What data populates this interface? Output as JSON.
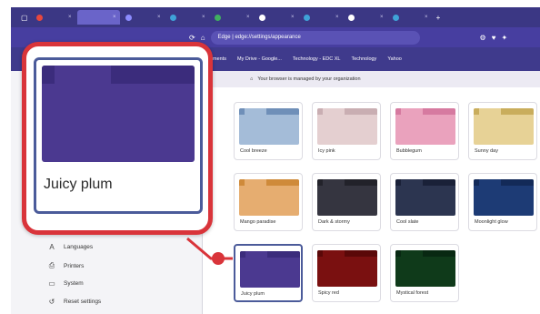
{
  "browser": {
    "tabs": [
      {
        "label": "",
        "color": "#e8473d"
      },
      {
        "label": "",
        "color": "#6a64c9"
      },
      {
        "label": "",
        "color": "#8c8cff"
      },
      {
        "label": "",
        "color": "#3fa3d8"
      },
      {
        "label": "",
        "color": "#40b060"
      },
      {
        "label": "",
        "color": "#ffffff"
      },
      {
        "label": "",
        "color": "#3fa3d8"
      },
      {
        "label": "",
        "color": "#ffffff"
      },
      {
        "label": "",
        "color": "#3fa3d8"
      }
    ],
    "address": "Edge | edge://settings/appearance",
    "bookmarks": [
      "ments",
      "My Drive - Google...",
      "Technology - EDC XL",
      "Technology",
      "Yahoo"
    ]
  },
  "banner": {
    "text": "Your browser is managed by your organization"
  },
  "sidebar": {
    "items": [
      {
        "label": "Languages",
        "icon": "language-icon"
      },
      {
        "label": "Printers",
        "icon": "printer-icon"
      },
      {
        "label": "System",
        "icon": "system-icon"
      },
      {
        "label": "Reset settings",
        "icon": "reset-icon"
      }
    ]
  },
  "themes": [
    {
      "name": "Cool breeze",
      "color": "#a4bcd8",
      "strip": "#6f8fb8"
    },
    {
      "name": "Icy pink",
      "color": "#e4cfd0",
      "strip": "#c9aeb2"
    },
    {
      "name": "Bubblegum",
      "color": "#eaa2bd",
      "strip": "#d67aa0"
    },
    {
      "name": "Sunny day",
      "color": "#e7d296",
      "strip": "#c9ad5c"
    },
    {
      "name": "Mango paradise",
      "color": "#e6ad70",
      "strip": "#cf8a3a"
    },
    {
      "name": "Dark & stormy",
      "color": "#353540",
      "strip": "#22222a"
    },
    {
      "name": "Cool slate",
      "color": "#2c3550",
      "strip": "#1a2138"
    },
    {
      "name": "Moonlight glow",
      "color": "#1d3b75",
      "strip": "#132a58"
    },
    {
      "name": "Juicy plum",
      "color": "#4b3990",
      "strip": "#3b2c7c",
      "selected": true
    },
    {
      "name": "Spicy red",
      "color": "#7a1010",
      "strip": "#5a0808"
    },
    {
      "name": "Mystical forest",
      "color": "#0f3a1a",
      "strip": "#082812"
    }
  ],
  "callout": {
    "label": "Juicy plum"
  },
  "colors": {
    "callout_border": "#d9343a",
    "selected_border": "#4b5b9a"
  }
}
